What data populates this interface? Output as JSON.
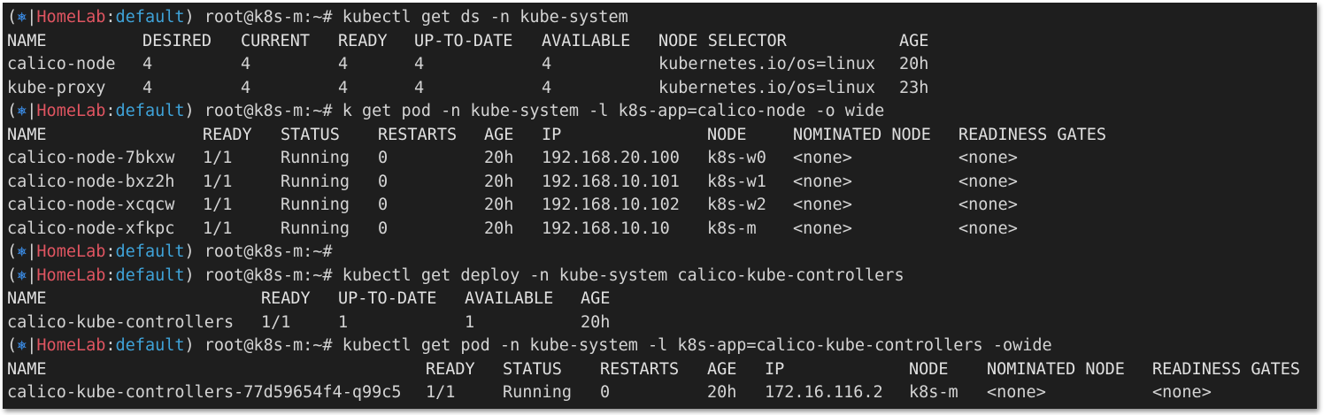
{
  "prompt": {
    "open": "(",
    "icon": "⎈",
    "sep": "|",
    "cluster": "HomeLab",
    "colon": ":",
    "namespace": "default",
    "close": ")",
    "user_host": " root@k8s-m:~# "
  },
  "commands": [
    "kubectl get ds -n kube-system",
    "k get pod -n kube-system -l k8s-app=calico-node -o wide",
    "",
    "kubectl get deploy -n kube-system calico-kube-controllers",
    "kubectl get pod -n kube-system -l k8s-app=calico-kube-controllers -owide"
  ],
  "ds_table": {
    "headers": [
      "NAME",
      "DESIRED",
      "CURRENT",
      "READY",
      "UP-TO-DATE",
      "AVAILABLE",
      "NODE SELECTOR",
      "AGE"
    ],
    "rows": [
      [
        "calico-node",
        "4",
        "4",
        "4",
        "4",
        "4",
        "kubernetes.io/os=linux",
        "20h"
      ],
      [
        "kube-proxy",
        "4",
        "4",
        "4",
        "4",
        "4",
        "kubernetes.io/os=linux",
        "23h"
      ]
    ]
  },
  "pod_table": {
    "headers": [
      "NAME",
      "READY",
      "STATUS",
      "RESTARTS",
      "AGE",
      "IP",
      "NODE",
      "NOMINATED NODE",
      "READINESS GATES"
    ],
    "rows": [
      [
        "calico-node-7bkxw",
        "1/1",
        "Running",
        "0",
        "20h",
        "192.168.20.100",
        "k8s-w0",
        "<none>",
        "<none>"
      ],
      [
        "calico-node-bxz2h",
        "1/1",
        "Running",
        "0",
        "20h",
        "192.168.10.101",
        "k8s-w1",
        "<none>",
        "<none>"
      ],
      [
        "calico-node-xcqcw",
        "1/1",
        "Running",
        "0",
        "20h",
        "192.168.10.102",
        "k8s-w2",
        "<none>",
        "<none>"
      ],
      [
        "calico-node-xfkpc",
        "1/1",
        "Running",
        "0",
        "20h",
        "192.168.10.10",
        "k8s-m",
        "<none>",
        "<none>"
      ]
    ]
  },
  "deploy_table": {
    "headers": [
      "NAME",
      "READY",
      "UP-TO-DATE",
      "AVAILABLE",
      "AGE"
    ],
    "rows": [
      [
        "calico-kube-controllers",
        "1/1",
        "1",
        "1",
        "20h"
      ]
    ]
  },
  "ctrl_table": {
    "headers": [
      "NAME",
      "READY",
      "STATUS",
      "RESTARTS",
      "AGE",
      "IP",
      "NODE",
      "NOMINATED NODE",
      "READINESS GATES"
    ],
    "rows": [
      [
        "calico-kube-controllers-77d59654f4-q99c5",
        "1/1",
        "Running",
        "0",
        "20h",
        "172.16.116.2",
        "k8s-m",
        "<none>",
        "<none>"
      ]
    ]
  },
  "colors": {
    "background": "#1e1e1e",
    "text": "#d4d4d4",
    "cluster": "#e05561",
    "namespace": "#3fa3d9",
    "icon": "#3b8eea"
  }
}
